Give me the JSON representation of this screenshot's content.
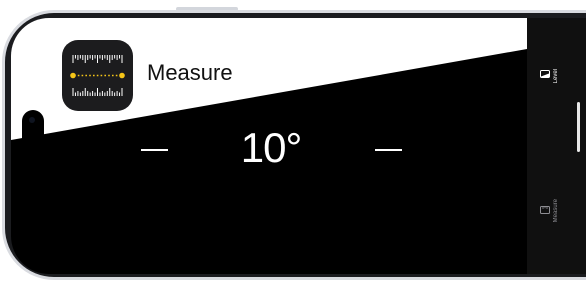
{
  "app": {
    "name": "Measure",
    "icon": "measure-app-icon",
    "icon_bg_color": "#1c1c1e",
    "icon_accent_color": "#f5c518"
  },
  "level": {
    "angle_value": "10",
    "angle_unit": "°",
    "angle_degrees": 10,
    "surface_color": "#ffffff",
    "background_color": "#000000"
  },
  "tab_bar": {
    "items": [
      {
        "label": "Level",
        "icon": "level-icon",
        "selected": true
      },
      {
        "label": "Measure",
        "icon": "measure-icon",
        "selected": false
      }
    ]
  }
}
